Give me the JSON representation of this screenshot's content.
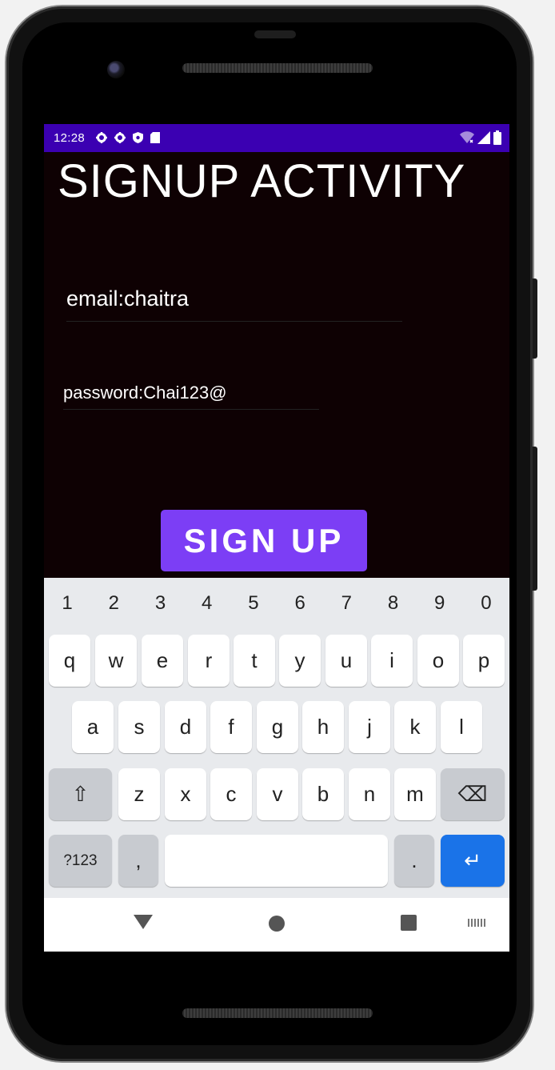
{
  "status_bar": {
    "time": "12:28",
    "left_icons": [
      "settings-icon",
      "settings-icon",
      "shield-icon",
      "sd-card-icon"
    ],
    "right_icons": [
      "wifi-icon",
      "signal-icon",
      "battery-icon"
    ],
    "color": "#3b00b2"
  },
  "app": {
    "title": "SIGNUP ACTIVITY",
    "email_value": "email:chaitra",
    "password_value": "password:Chai123@",
    "signup_label": "SIGN UP",
    "background": "#0e0103",
    "button_color": "#7c3ef5"
  },
  "keyboard": {
    "number_row": [
      "1",
      "2",
      "3",
      "4",
      "5",
      "6",
      "7",
      "8",
      "9",
      "0"
    ],
    "row1": [
      "q",
      "w",
      "e",
      "r",
      "t",
      "y",
      "u",
      "i",
      "o",
      "p"
    ],
    "row2": [
      "a",
      "s",
      "d",
      "f",
      "g",
      "h",
      "j",
      "k",
      "l"
    ],
    "row3": [
      "z",
      "x",
      "c",
      "v",
      "b",
      "n",
      "m"
    ],
    "symbols_label": "?123",
    "comma_label": ",",
    "period_label": ".",
    "shift_glyph": "⇧",
    "backspace_glyph": "⌫",
    "enter_glyph": "↵"
  },
  "nav_icons": [
    "back-icon",
    "home-icon",
    "recents-icon",
    "keyboard-icon"
  ]
}
